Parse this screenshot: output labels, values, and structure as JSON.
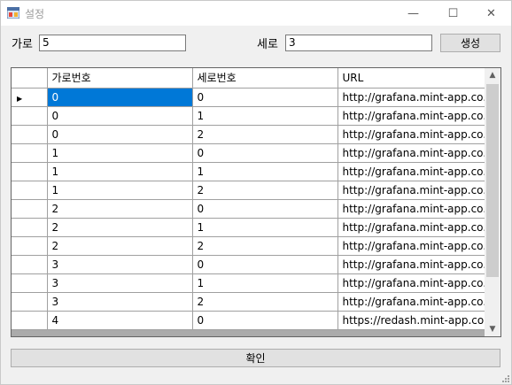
{
  "window": {
    "title": "설정",
    "minimize": "—",
    "maximize": "☐",
    "close": "✕"
  },
  "form": {
    "width_label": "가로",
    "width_value": "5",
    "height_label": "세로",
    "height_value": "3",
    "generate_button": "생성",
    "confirm_button": "확인"
  },
  "grid": {
    "columns": [
      "가로번호",
      "세로번호",
      "URL"
    ],
    "rows": [
      [
        "0",
        "0",
        "http://grafana.mint-app.co...."
      ],
      [
        "0",
        "1",
        "http://grafana.mint-app.co...."
      ],
      [
        "0",
        "2",
        "http://grafana.mint-app.co...."
      ],
      [
        "1",
        "0",
        "http://grafana.mint-app.co...."
      ],
      [
        "1",
        "1",
        "http://grafana.mint-app.co...."
      ],
      [
        "1",
        "2",
        "http://grafana.mint-app.co...."
      ],
      [
        "2",
        "0",
        "http://grafana.mint-app.co...."
      ],
      [
        "2",
        "1",
        "http://grafana.mint-app.co...."
      ],
      [
        "2",
        "2",
        "http://grafana.mint-app.co...."
      ],
      [
        "3",
        "0",
        "http://grafana.mint-app.co...."
      ],
      [
        "3",
        "1",
        "http://grafana.mint-app.co...."
      ],
      [
        "3",
        "2",
        "http://grafana.mint-app.co...."
      ],
      [
        "4",
        "0",
        "https://redash.mint-app.co...."
      ]
    ],
    "current_row_indicator": "▶",
    "scroll_up": "▲",
    "scroll_down": "▼"
  },
  "colors": {
    "selection": "#0078d7",
    "window_bg": "#f0f0f0"
  }
}
